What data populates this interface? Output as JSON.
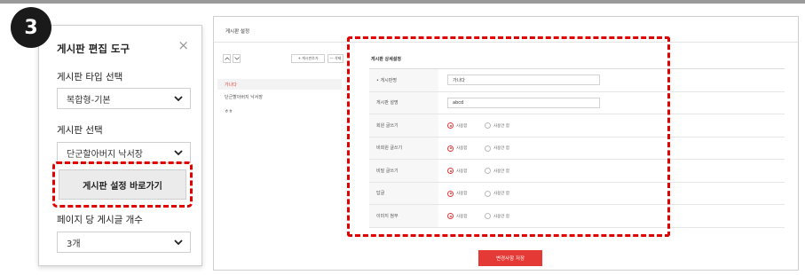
{
  "step": {
    "number": "3"
  },
  "tool_panel": {
    "title": "게시판 편집 도구",
    "close_glyph": "×",
    "board_type_label": "게시판 타입 선택",
    "board_type_value": "복합형-기본",
    "board_select_label": "게시판 선택",
    "board_select_value": "단군할아버지 낙서장",
    "shortcut_button": "게시판 설정 바로가기",
    "posts_per_page_label": "페이지 당 게시글 개수",
    "posts_per_page_value": "3개"
  },
  "admin": {
    "title": "게시판 설정",
    "add_board_btn": "+ 게시판추가",
    "delete_btn": "— 삭제",
    "list_items": [
      "가나다",
      "단군할아버지 낙서장",
      "ㅎㅎ"
    ],
    "detail_title": "게시판 상세설정",
    "rows": [
      {
        "label": "• 게시판명",
        "type": "input",
        "value": "가나다"
      },
      {
        "label": "게시판 설명",
        "type": "input",
        "value": "abcd"
      },
      {
        "label": "회원 글쓰기",
        "type": "radio",
        "on": "사용함",
        "off": "사용안 함"
      },
      {
        "label": "비회원 글쓰기",
        "type": "radio",
        "on": "사용함",
        "off": "사용안 함"
      },
      {
        "label": "비밀 글쓰기",
        "type": "radio",
        "on": "사용함",
        "off": "사용안 함"
      },
      {
        "label": "답글",
        "type": "radio",
        "on": "사용함",
        "off": "사용안 함"
      },
      {
        "label": "이미지 첨부",
        "type": "radio",
        "on": "사용함",
        "off": "사용안 함"
      }
    ],
    "save_button": "변경사항 저장"
  },
  "colors": {
    "highlight": "#e00000",
    "accent": "#e53935"
  }
}
